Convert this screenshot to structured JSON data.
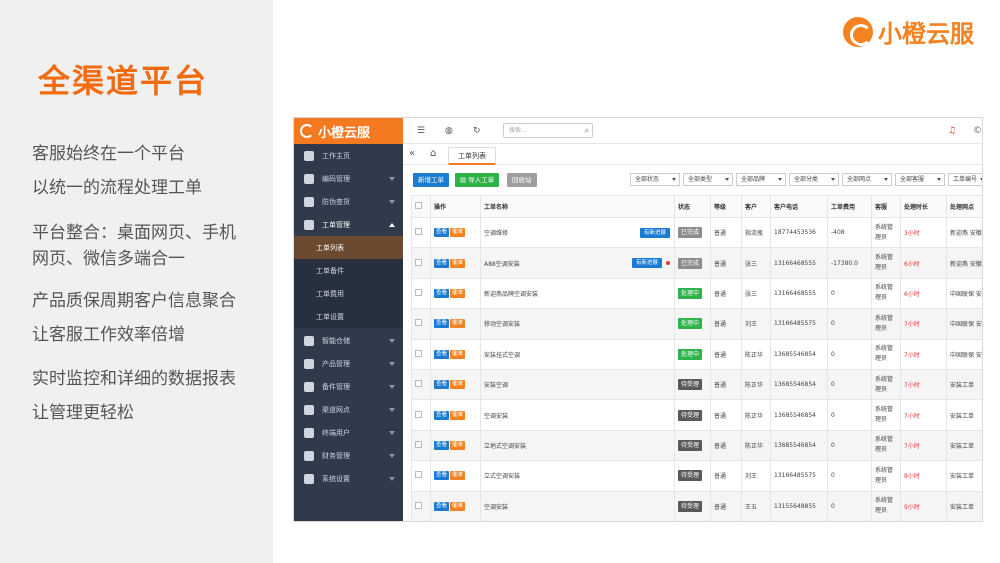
{
  "slide": {
    "title": "全渠道平台",
    "bullets": [
      "客服始终在一个平台",
      "以统一的流程处理工单",
      "平台整合：桌面网页、手机",
      "网页、微信多端合一",
      "产品质保周期客户信息聚合",
      "让客服工作效率倍增",
      "实时监控和详细的数据报表",
      "让管理更轻松"
    ],
    "brand": "小橙云服"
  },
  "app": {
    "logo": "小橙云服",
    "search_placeholder": "搜索...",
    "nav": [
      {
        "label": "工作主页",
        "icon": "monitor-icon"
      },
      {
        "label": "编码管理",
        "icon": "grid-icon"
      },
      {
        "label": "防伪查货",
        "icon": "settings-icon"
      },
      {
        "label": "工单管理",
        "icon": "document-icon"
      },
      {
        "label": "智能仓储",
        "icon": "warehouse-icon"
      },
      {
        "label": "产品管理",
        "icon": "box-icon"
      },
      {
        "label": "备件管理",
        "icon": "parts-icon"
      },
      {
        "label": "渠道网点",
        "icon": "globe-icon"
      },
      {
        "label": "终端用户",
        "icon": "user-icon"
      },
      {
        "label": "财务管理",
        "icon": "finance-icon"
      },
      {
        "label": "系统设置",
        "icon": "gear-icon"
      }
    ],
    "subnav": [
      "工单列表",
      "工单备件",
      "工单费用",
      "工单设置"
    ],
    "tab": "工单列表",
    "buttons": {
      "new": "新增工单",
      "import": "导入工单",
      "recycle": "回收站"
    },
    "filters": [
      "全部状态",
      "全部类型",
      "全部品牌",
      "全部分类",
      "全部网点",
      "全部客服",
      "工单编号"
    ],
    "columns": [
      "操作",
      "工单名称",
      "状态",
      "等级",
      "客户",
      "客户电话",
      "工单费用",
      "客服",
      "处理时长",
      "处理网点"
    ],
    "action_view": "查看",
    "action_urge": "催单",
    "progress_label": "有新进展",
    "rows": [
      {
        "name": "空调维修",
        "status": "已完成",
        "status_color": "#8c8c8c",
        "level": "普通",
        "customer": "指流瓶",
        "phone": "18774453536",
        "fee": "-408",
        "agent": "系统管理员",
        "duration": "3小时",
        "outlet": "新迎燕 安徽",
        "progress": true,
        "dot": false
      },
      {
        "name": "A88空调安装",
        "status": "已完成",
        "status_color": "#8c8c8c",
        "level": "普通",
        "customer": "张三",
        "phone": "13166468555",
        "fee": "-17380.0",
        "agent": "系统管理员",
        "duration": "6小时",
        "outlet": "新迎燕 安徽",
        "progress": true,
        "dot": true
      },
      {
        "name": "新迎燕品牌空调安装",
        "status": "处理中",
        "status_color": "#2db34a",
        "level": "普通",
        "customer": "张三",
        "phone": "13166468555",
        "fee": "0",
        "agent": "系统管理员",
        "duration": "6小时",
        "outlet": "中国联保 安",
        "progress": false,
        "dot": false
      },
      {
        "name": "移动空调安装",
        "status": "处理中",
        "status_color": "#2db34a",
        "level": "普通",
        "customer": "刘王",
        "phone": "13166485575",
        "fee": "0",
        "agent": "系统管理员",
        "duration": "7小时",
        "outlet": "中国联保 安",
        "progress": false,
        "dot": false
      },
      {
        "name": "安装挂式空调",
        "status": "处理中",
        "status_color": "#2db34a",
        "level": "普通",
        "customer": "陈正华",
        "phone": "13685546854",
        "fee": "0",
        "agent": "系统管理员",
        "duration": "7小时",
        "outlet": "中国联保 安",
        "progress": false,
        "dot": false
      },
      {
        "name": "安装空调",
        "status": "待受理",
        "status_color": "#595959",
        "level": "普通",
        "customer": "陈正华",
        "phone": "13685546854",
        "fee": "0",
        "agent": "系统管理员",
        "duration": "7小时",
        "outlet": "安装工单",
        "progress": false,
        "dot": false
      },
      {
        "name": "空调安装",
        "status": "待受理",
        "status_color": "#595959",
        "level": "普通",
        "customer": "陈正华",
        "phone": "13685546854",
        "fee": "0",
        "agent": "系统管理员",
        "duration": "7小时",
        "outlet": "安装工单",
        "progress": false,
        "dot": false
      },
      {
        "name": "立地式空调安装",
        "status": "待受理",
        "status_color": "#595959",
        "level": "普通",
        "customer": "陈正华",
        "phone": "13685546854",
        "fee": "0",
        "agent": "系统管理员",
        "duration": "7小时",
        "outlet": "安装工单",
        "progress": false,
        "dot": false
      },
      {
        "name": "立式空调安装",
        "status": "待受理",
        "status_color": "#595959",
        "level": "普通",
        "customer": "刘王",
        "phone": "13166485575",
        "fee": "0",
        "agent": "系统管理员",
        "duration": "8小时",
        "outlet": "安装工单",
        "progress": false,
        "dot": false
      },
      {
        "name": "空调安装",
        "status": "待受理",
        "status_color": "#595959",
        "level": "普通",
        "customer": "王五",
        "phone": "13155648855",
        "fee": "0",
        "agent": "系统管理员",
        "duration": "9小时",
        "outlet": "安装工单",
        "progress": false,
        "dot": false
      }
    ]
  },
  "colors": {
    "accent": "#f47920",
    "sidebar": "#2f3a4b",
    "view": "#1a7bd1",
    "urge": "#f58220",
    "new_btn": "#1a7bd1",
    "import_btn": "#2db34a",
    "recycle_btn": "#9e9e9e"
  }
}
